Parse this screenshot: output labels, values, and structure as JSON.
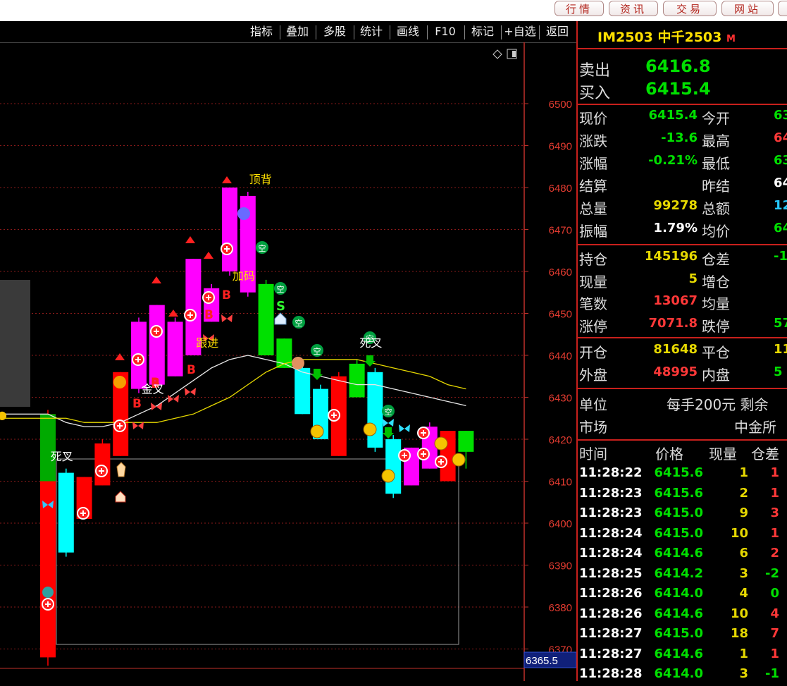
{
  "nav": {
    "buttons": [
      "行情",
      "资讯",
      "交易",
      "网站"
    ]
  },
  "toolbar": {
    "items": [
      "指标",
      "叠加",
      "多股",
      "统计",
      "画线",
      "F10",
      "标记",
      "+自选",
      "返回"
    ]
  },
  "chart_data": {
    "type": "candlestick",
    "y_ticks": [
      6500,
      6490,
      6480,
      6470,
      6460,
      6450,
      6440,
      6430,
      6420,
      6410,
      6400,
      6390,
      6380,
      6370
    ],
    "ylim": [
      6368,
      6509
    ],
    "cursor_label": "6365.5",
    "candles": [
      {
        "o": 6426,
        "c": 6368,
        "h": 6427,
        "l": 6366,
        "color": "red"
      },
      {
        "o": 6393,
        "c": 6412,
        "h": 6413,
        "l": 6392,
        "color": "cyan"
      },
      {
        "o": 6401,
        "c": 6411,
        "h": 6411,
        "l": 6401,
        "color": "red"
      },
      {
        "o": 6409,
        "c": 6419,
        "h": 6420,
        "l": 6409,
        "color": "red"
      },
      {
        "o": 6416,
        "c": 6436,
        "h": 6436,
        "l": 6416,
        "color": "red"
      },
      {
        "o": 6432,
        "c": 6448,
        "h": 6449,
        "l": 6431,
        "color": "magenta"
      },
      {
        "o": 6433,
        "c": 6452,
        "h": 6452,
        "l": 6433,
        "color": "magenta"
      },
      {
        "o": 6435,
        "c": 6448,
        "h": 6449,
        "l": 6435,
        "color": "magenta"
      },
      {
        "o": 6440,
        "c": 6463,
        "h": 6463,
        "l": 6440,
        "color": "magenta"
      },
      {
        "o": 6448,
        "c": 6456,
        "h": 6457,
        "l": 6448,
        "color": "magenta"
      },
      {
        "o": 6460,
        "c": 6480,
        "h": 6480,
        "l": 6459,
        "color": "magenta"
      },
      {
        "o": 6455,
        "c": 6478,
        "h": 6479,
        "l": 6454,
        "color": "magenta"
      },
      {
        "o": 6457,
        "c": 6440,
        "h": 6458,
        "l": 6440,
        "color": "green"
      },
      {
        "o": 6444,
        "c": 6437,
        "h": 6444,
        "l": 6437,
        "color": "green"
      },
      {
        "o": 6437,
        "c": 6426,
        "h": 6438,
        "l": 6426,
        "color": "cyan"
      },
      {
        "o": 6432,
        "c": 6420,
        "h": 6433,
        "l": 6420,
        "color": "cyan"
      },
      {
        "o": 6435,
        "c": 6416,
        "h": 6436,
        "l": 6416,
        "color": "red"
      },
      {
        "o": 6438,
        "c": 6430,
        "h": 6439,
        "l": 6430,
        "color": "green"
      },
      {
        "o": 6436,
        "c": 6418,
        "h": 6437,
        "l": 6417,
        "color": "cyan"
      },
      {
        "o": 6420,
        "c": 6407,
        "h": 6421,
        "l": 6406,
        "color": "cyan"
      },
      {
        "o": 6418,
        "c": 6409,
        "h": 6418,
        "l": 6409,
        "color": "magenta"
      },
      {
        "o": 6423,
        "c": 6413,
        "h": 6424,
        "l": 6413,
        "color": "magenta"
      },
      {
        "o": 6422,
        "c": 6410,
        "h": 6422,
        "l": 6410,
        "color": "red"
      },
      {
        "o": 6417,
        "c": 6422,
        "h": 6422,
        "l": 6413,
        "color": "green"
      }
    ],
    "ma_white": [
      6426,
      6424,
      6423,
      6423,
      6424,
      6426,
      6428,
      6431,
      6434,
      6437,
      6439,
      6440,
      6439,
      6438,
      6436,
      6435,
      6434,
      6433,
      6433,
      6432,
      6431,
      6430,
      6429,
      6428
    ],
    "ma_yellow": [
      6425,
      6425,
      6424,
      6424,
      6424,
      6424,
      6424,
      6425,
      6426,
      6428,
      6430,
      6433,
      6436,
      6438,
      6439,
      6439,
      6439,
      6439,
      6438,
      6437,
      6436,
      6435,
      6433,
      6432
    ],
    "annotations": [
      {
        "text": "顶背",
        "i": 11,
        "v": 6481,
        "color": "#ffe000"
      },
      {
        "text": "加码",
        "i": 11,
        "v": 6458,
        "color": "#ffe000"
      },
      {
        "text": "跟进",
        "i": 9,
        "v": 6442,
        "color": "#ffe000"
      },
      {
        "text": "金叉",
        "i": 6,
        "v": 6431,
        "color": "#ffffff"
      },
      {
        "text": "死叉",
        "i": 1,
        "v": 6415,
        "color": "#ffffff"
      },
      {
        "text": "死叉",
        "i": 18,
        "v": 6442,
        "color": "#ffffff"
      }
    ]
  },
  "quote": {
    "code": "IM2503",
    "name": "中千2503",
    "flag": "M",
    "sell_label": "卖出",
    "sell": "6416.8",
    "buy_label": "买入",
    "buy": "6415.4",
    "rows": [
      {
        "l1": "现价",
        "v1": "6415.4",
        "c1": "green",
        "l2": "今开",
        "v2": "63",
        "c2": "green"
      },
      {
        "l1": "涨跌",
        "v1": "-13.6",
        "c1": "green",
        "l2": "最高",
        "v2": "64",
        "c2": "red"
      },
      {
        "l1": "涨幅",
        "v1": "-0.21%",
        "c1": "green",
        "l2": "最低",
        "v2": "63",
        "c2": "green"
      },
      {
        "l1": "结算",
        "v1": "",
        "c1": "white",
        "l2": "昨结",
        "v2": "64",
        "c2": "white"
      },
      {
        "l1": "总量",
        "v1": "99278",
        "c1": "yellow",
        "l2": "总额",
        "v2": "12",
        "c2": "cyan"
      },
      {
        "l1": "振幅",
        "v1": "1.79%",
        "c1": "white",
        "l2": "均价",
        "v2": "64",
        "c2": "green"
      }
    ],
    "rows2": [
      {
        "l1": "持仓",
        "v1": "145196",
        "c1": "yellow",
        "l2": "仓差",
        "v2": "-1",
        "c2": "green"
      },
      {
        "l1": "现量",
        "v1": "5",
        "c1": "yellow",
        "l2": "增仓",
        "v2": "",
        "c2": "white"
      },
      {
        "l1": "笔数",
        "v1": "13067",
        "c1": "red",
        "l2": "均量",
        "v2": "",
        "c2": "white"
      },
      {
        "l1": "涨停",
        "v1": "7071.8",
        "c1": "red",
        "l2": "跌停",
        "v2": "57",
        "c2": "green"
      }
    ],
    "rows3": [
      {
        "l1": "开仓",
        "v1": "81648",
        "c1": "yellow",
        "l2": "平仓",
        "v2": "11",
        "c2": "yellow"
      },
      {
        "l1": "外盘",
        "v1": "48995",
        "c1": "red",
        "l2": "内盘",
        "v2": "5",
        "c2": "green"
      }
    ],
    "unit_label": "单位",
    "unit_value": "每手200元 剩余",
    "market_label": "市场",
    "market_value": "中金所",
    "ticks_header": [
      "时间",
      "价格",
      "现量",
      "仓差"
    ],
    "ticks": [
      [
        "11:28:22",
        "6415.6",
        "1",
        "1"
      ],
      [
        "11:28:23",
        "6415.6",
        "2",
        "1"
      ],
      [
        "11:28:23",
        "6415.0",
        "9",
        "3"
      ],
      [
        "11:28:24",
        "6415.0",
        "10",
        "1"
      ],
      [
        "11:28:24",
        "6414.6",
        "6",
        "2"
      ],
      [
        "11:28:25",
        "6414.2",
        "3",
        "-2"
      ],
      [
        "11:28:26",
        "6414.0",
        "4",
        "0"
      ],
      [
        "11:28:26",
        "6414.6",
        "10",
        "4"
      ],
      [
        "11:28:27",
        "6415.0",
        "18",
        "7"
      ],
      [
        "11:28:27",
        "6414.6",
        "1",
        "1"
      ],
      [
        "11:28:28",
        "6414.0",
        "3",
        "-1"
      ]
    ]
  }
}
